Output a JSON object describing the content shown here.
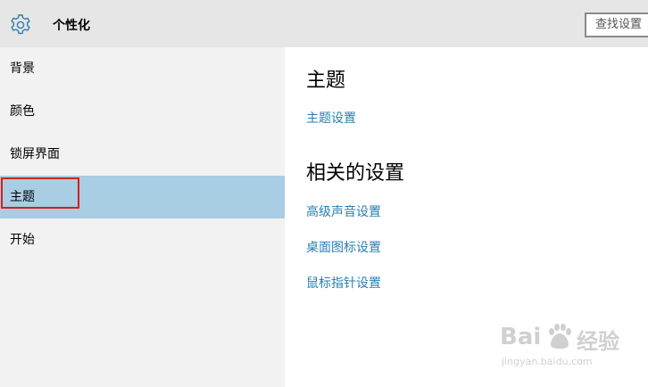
{
  "header": {
    "title": "个性化",
    "search_placeholder": "查找设置",
    "icon": "gear-icon"
  },
  "sidebar": {
    "items": [
      {
        "label": "背景"
      },
      {
        "label": "颜色"
      },
      {
        "label": "锁屏界面"
      },
      {
        "label": "主题",
        "selected": true
      },
      {
        "label": "开始"
      }
    ]
  },
  "main": {
    "section_title": "主题",
    "theme_settings_link": "主题设置",
    "related_title": "相关的设置",
    "related_links": [
      {
        "label": "高级声音设置"
      },
      {
        "label": "桌面图标设置"
      },
      {
        "label": "鼠标指针设置"
      }
    ]
  },
  "watermark": {
    "brand_left": "Bai",
    "brand_right": "经验",
    "url": "jingyan.baidu.com"
  },
  "colors": {
    "header_bg": "#e6e6e6",
    "sidebar_bg": "#f2f2f2",
    "selected_bg": "#a9cde3",
    "link": "#2a7fb1",
    "highlight_border": "#d12020"
  }
}
